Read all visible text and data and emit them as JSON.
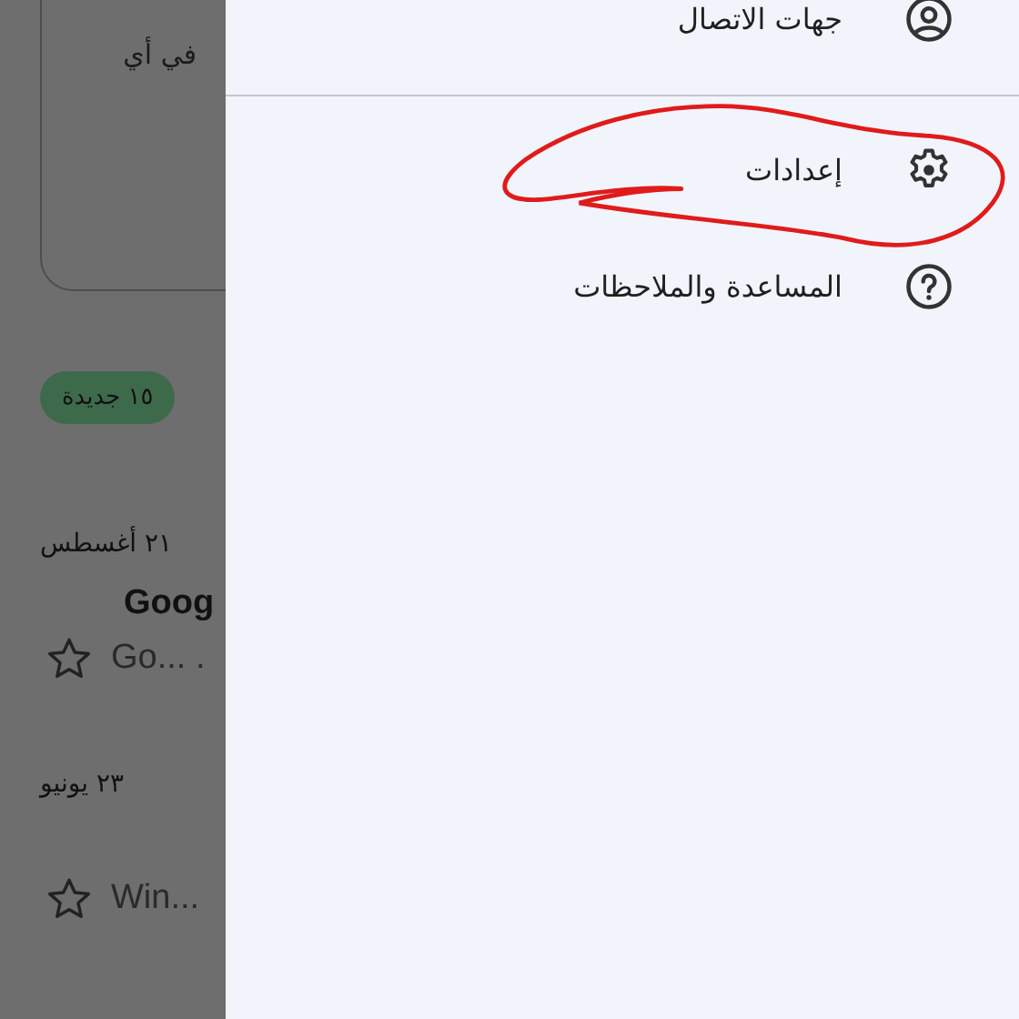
{
  "inbox": {
    "card_text": "في أي",
    "new_badge": "١٥ جديدة",
    "groups": [
      {
        "date": "٢١ أغسطس",
        "sender": "Goog",
        "snippet": "Go... .",
        "starred": false
      },
      {
        "date": "٢٣ يونيو",
        "snippet": "Win...",
        "starred": false
      }
    ]
  },
  "drawer": {
    "sections": [
      [
        {
          "label": "جهات الاتصال",
          "kind": "contacts"
        }
      ],
      [
        {
          "label": "إعدادات",
          "kind": "settings"
        },
        {
          "label": "المساعدة والملاحظات",
          "kind": "help"
        }
      ]
    ]
  }
}
